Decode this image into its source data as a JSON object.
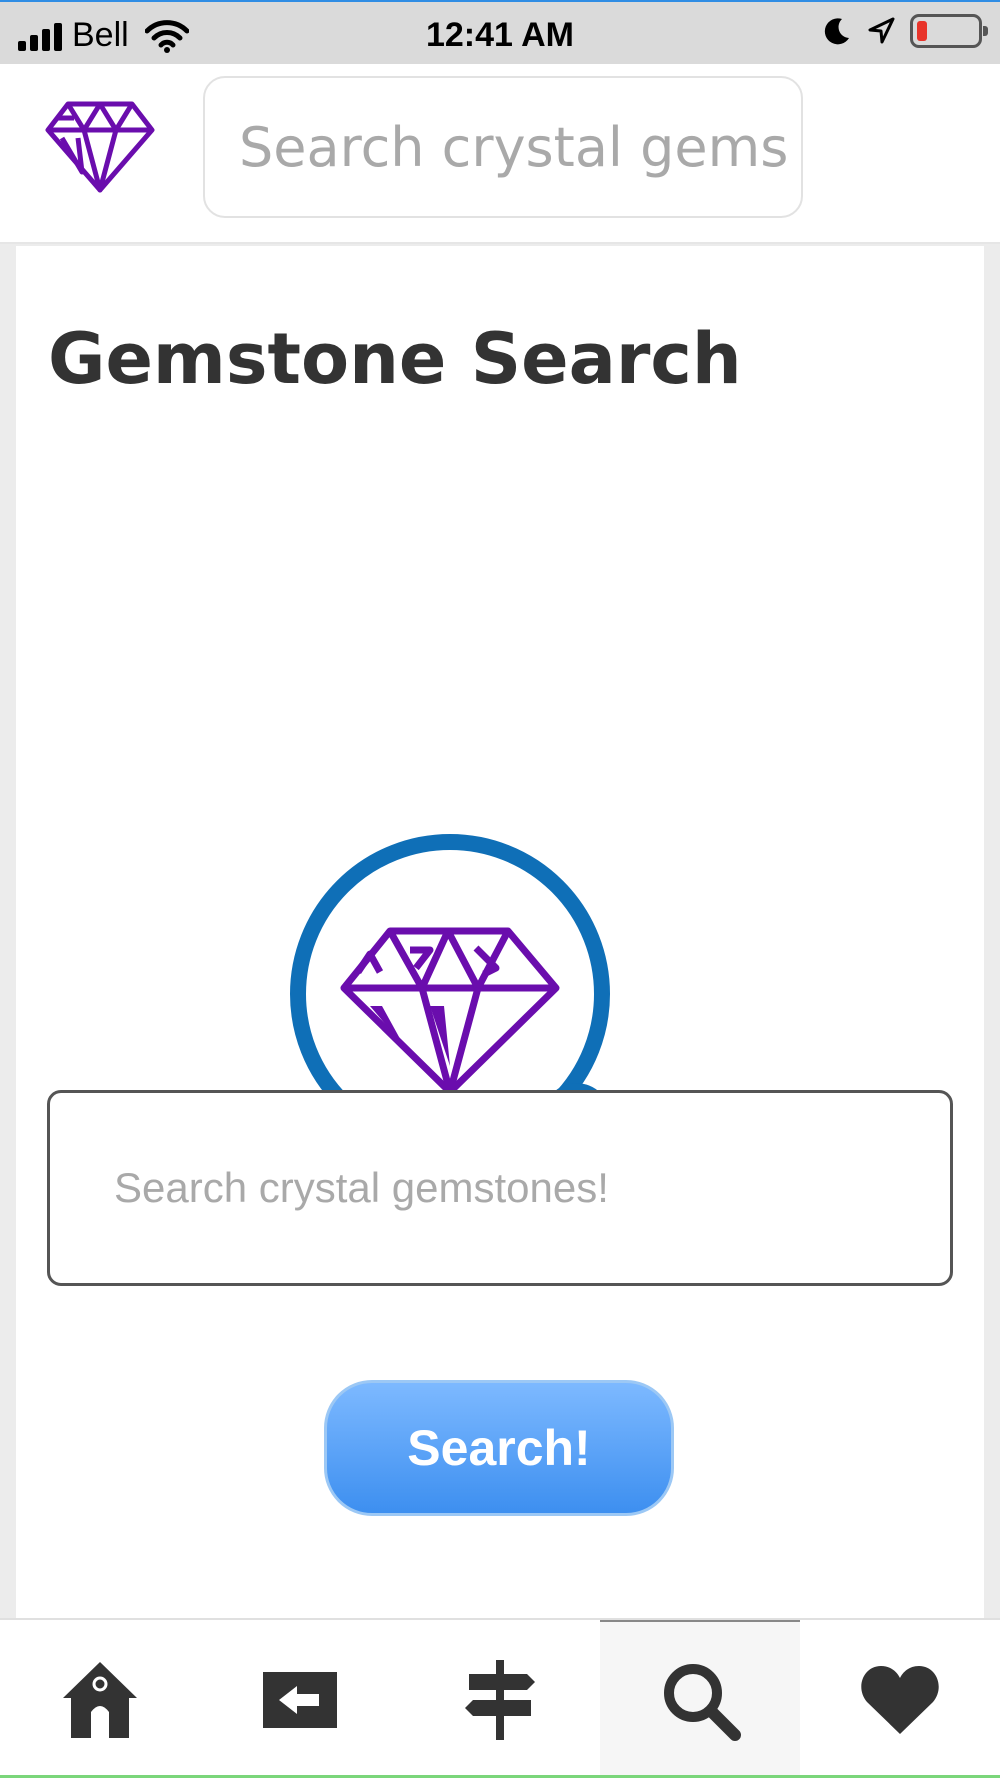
{
  "status_bar": {
    "carrier": "Bell",
    "time": "12:41 AM"
  },
  "header": {
    "search_placeholder": "Search crystal gems"
  },
  "main": {
    "title": "Gemstone Search",
    "search_placeholder": "Search crystal gemstones!",
    "search_button": "Search!"
  },
  "bottom_nav": {
    "items": [
      {
        "icon": "home-icon"
      },
      {
        "icon": "back-icon"
      },
      {
        "icon": "signpost-icon"
      },
      {
        "icon": "search-icon",
        "active": true
      },
      {
        "icon": "heart-icon"
      }
    ]
  },
  "colors": {
    "accent_purple": "#6a0dad",
    "magnifier_blue": "#0f6fb7",
    "button_blue": "#3d8ff0"
  }
}
